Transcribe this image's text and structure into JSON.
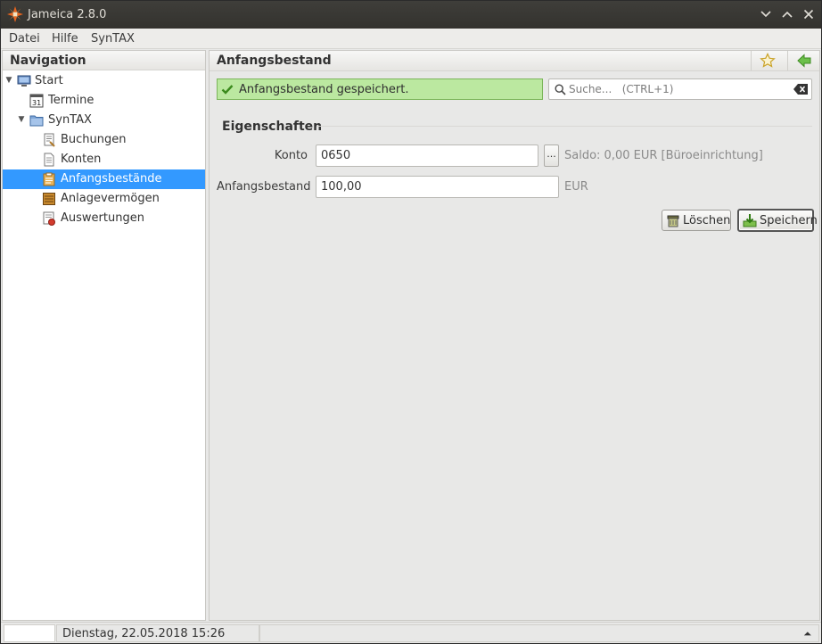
{
  "window": {
    "title": "Jameica 2.8.0",
    "controls": [
      "minimize",
      "maximize",
      "close"
    ]
  },
  "menu": {
    "items": [
      "Datei",
      "Hilfe",
      "SynTAX"
    ]
  },
  "navigation": {
    "title": "Navigation",
    "items": [
      {
        "label": "Start",
        "icon": "computer-icon",
        "expanded": true
      },
      {
        "label": "Termine",
        "icon": "calendar-icon"
      },
      {
        "label": "SynTAX",
        "icon": "folder-icon",
        "expanded": true
      },
      {
        "label": "Buchungen",
        "icon": "bookings-icon"
      },
      {
        "label": "Konten",
        "icon": "document-icon"
      },
      {
        "label": "Anfangsbestände",
        "icon": "clipboard-icon",
        "selected": true
      },
      {
        "label": "Anlagevermögen",
        "icon": "ledger-icon"
      },
      {
        "label": "Auswertungen",
        "icon": "report-icon"
      }
    ]
  },
  "main": {
    "title": "Anfangsbestand",
    "success_message": "Anfangsbestand gespeichert.",
    "search": {
      "placeholder": "Suche...   (CTRL+1)",
      "value": ""
    },
    "section_title": "Eigenschaften",
    "fields": {
      "konto_label": "Konto",
      "konto_value": "0650",
      "konto_button": "...",
      "konto_hint": "Saldo: 0,00 EUR [Büroeinrichtung]",
      "bestand_label": "Anfangsbestand",
      "bestand_value": "100,00",
      "bestand_unit": "EUR"
    },
    "buttons": {
      "delete": "Löschen",
      "save": "Speichern"
    }
  },
  "statusbar": {
    "datetime": "Dienstag, 22.05.2018 15:26"
  },
  "colors": {
    "selection": "#3399ff",
    "success_bg": "#bbe8a0",
    "titlebar": "#3c3b37"
  }
}
